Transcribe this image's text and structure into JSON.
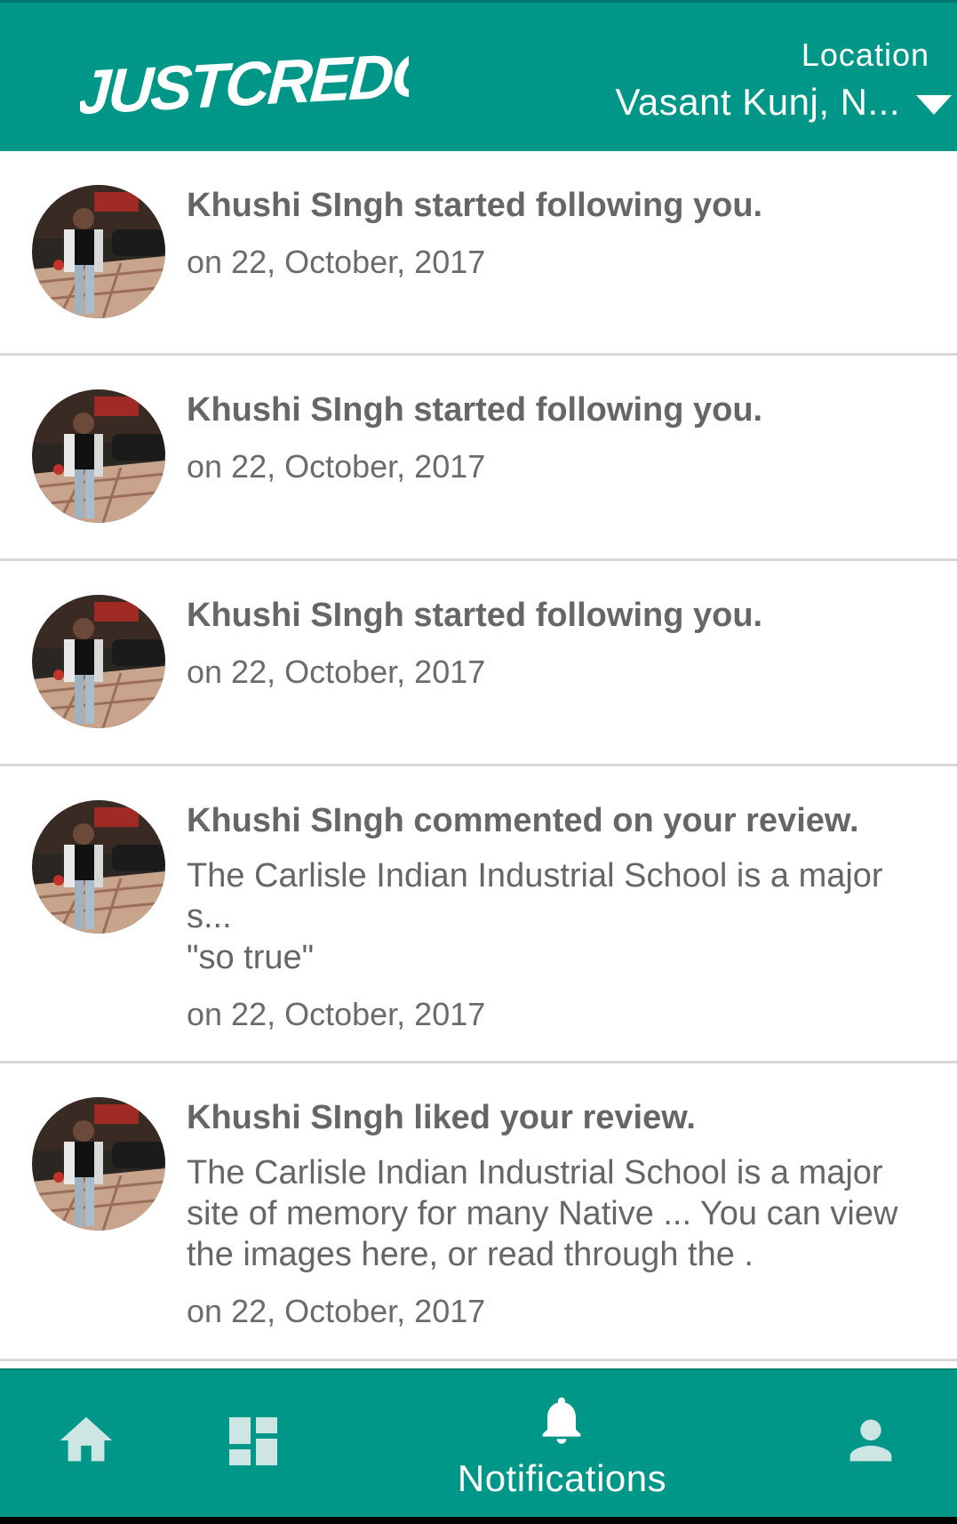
{
  "header": {
    "logo_text": "JUSTCREDO",
    "location_label": "Location",
    "location_value": "Vasant Kunj, N..."
  },
  "colors": {
    "primary": "#009688",
    "text": "#666666",
    "divider": "#d9d9d9"
  },
  "notifications": [
    {
      "title": "Khushi SIngh started following you.",
      "date": "on 22, October, 2017"
    },
    {
      "title": "Khushi SIngh started following you.",
      "date": "on 22, October, 2017"
    },
    {
      "title": "Khushi SIngh started following you.",
      "date": "on 22, October, 2017"
    },
    {
      "title": "Khushi SIngh commented on your review.",
      "body": "The Carlisle Indian Industrial School is a major s...",
      "quote": "\"so true\"",
      "date": "on 22, October, 2017"
    },
    {
      "title": "Khushi SIngh liked your review.",
      "body": "The Carlisle Indian Industrial School is a major site of memory for many Native ... You can view the images here, or read through the .",
      "date": "on 22, October, 2017"
    }
  ],
  "bottom_nav": {
    "items": [
      {
        "icon": "home-icon"
      },
      {
        "icon": "dashboard-icon"
      },
      {
        "icon": "bell-icon",
        "label": "Notifications",
        "active": true
      },
      {
        "icon": "person-icon"
      }
    ]
  }
}
